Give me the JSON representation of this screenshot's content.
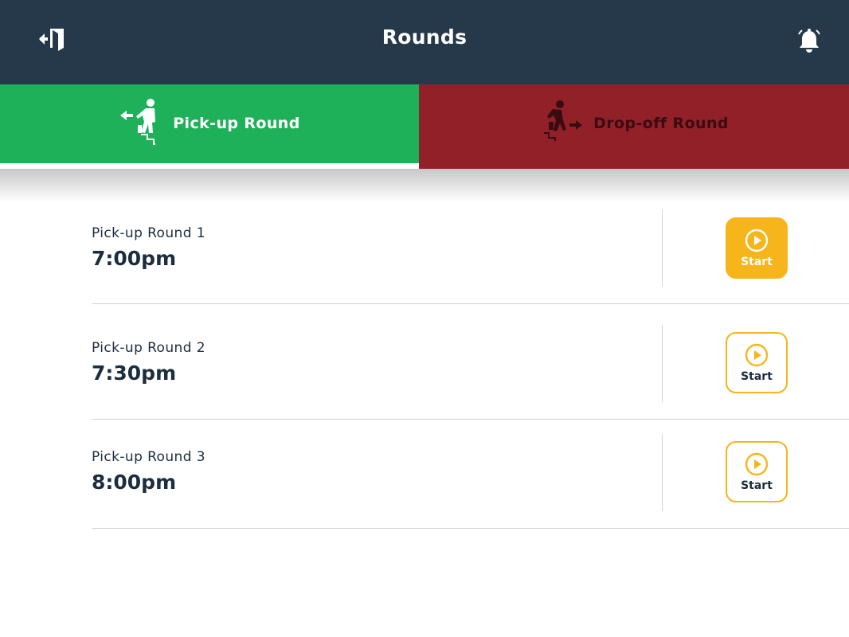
{
  "header": {
    "title": "Rounds",
    "exit_icon": "exit-door-icon",
    "bell_icon": "notification-bell-icon",
    "background": "#26394b"
  },
  "tabs": [
    {
      "label": "Pick-up Round",
      "icon": "pickup-person-icon",
      "color": "#1fb15a",
      "selected": true
    },
    {
      "label": "Drop-off Round",
      "icon": "dropoff-person-icon",
      "color": "#922029",
      "selected": false
    }
  ],
  "rounds": [
    {
      "name": "Pick-up Round 1",
      "time": "7:00pm",
      "button": "Start",
      "active": true
    },
    {
      "name": "Pick-up Round 2",
      "time": "7:30pm",
      "button": "Start",
      "active": false
    },
    {
      "name": "Pick-up Round 3",
      "time": "8:00pm",
      "button": "Start",
      "active": false
    }
  ],
  "colors": {
    "accent": "#f5b51b",
    "text": "#1c2d3d"
  }
}
